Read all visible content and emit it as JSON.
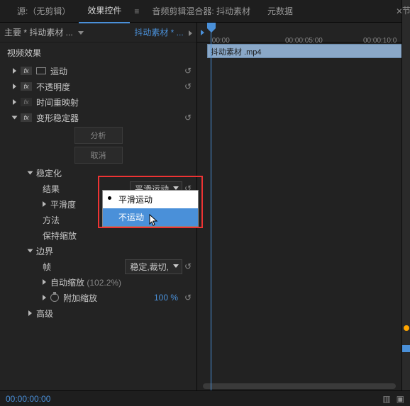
{
  "tabs": {
    "source": "源:（无剪辑）",
    "effect_controls": "效果控件",
    "audio_mixer": "音频剪辑混合器: 抖动素材",
    "metadata": "元数据"
  },
  "header": {
    "master": "主要 * 抖动素材 ...",
    "clip": "抖动素材 * ..."
  },
  "sections": {
    "video_effects": "视频效果"
  },
  "effects": {
    "motion": "运动",
    "opacity": "不透明度",
    "time_remap": "时间重映射",
    "warp_stabilizer": "变形稳定器"
  },
  "stabilizer": {
    "analyze_btn": "分析",
    "cancel_btn": "取消",
    "group_stabilize": "稳定化",
    "result_label": "结果",
    "result_value": "平滑运动",
    "smoothness_label": "平滑度",
    "method_label": "方法",
    "preserve_scale_label": "保持缩放",
    "group_border": "边界",
    "frame_label": "帧",
    "frame_value": "稳定,裁切,",
    "auto_scale_label": "自动缩放",
    "auto_scale_value": "(102.2%)",
    "extra_scale_label": "附加缩放",
    "extra_scale_value": "100 %",
    "advanced": "高级"
  },
  "dropdown": {
    "opt1": "平滑运动",
    "opt2": "不运动"
  },
  "timeline": {
    "t0": ":00:00",
    "t1": "00:00:05:00",
    "t2": "00:00:10:0",
    "clip_name": "抖动素材 .mp4"
  },
  "footer": {
    "time": "00:00:00:00"
  },
  "right_strip": {
    "label": "节"
  }
}
